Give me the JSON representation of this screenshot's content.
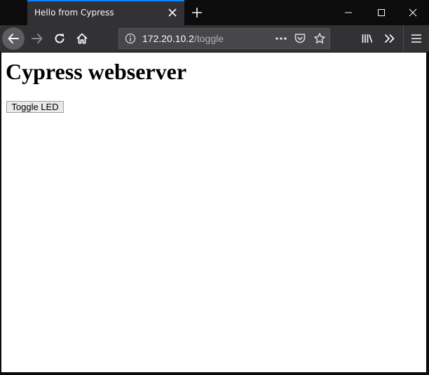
{
  "browser": {
    "tab": {
      "title": "Hello from Cypress"
    },
    "url": {
      "host": "172.20.10.2",
      "path": "/toggle"
    }
  },
  "page": {
    "heading": "Cypress webserver",
    "toggle_button_label": "Toggle LED"
  },
  "icons": {
    "tab_close": "close-icon",
    "new_tab": "plus-icon",
    "minimize": "minimize-icon",
    "maximize": "maximize-icon",
    "window_close": "close-icon",
    "back": "arrow-left-icon",
    "forward": "arrow-right-icon",
    "reload": "reload-icon",
    "home": "home-icon",
    "site_info": "info-icon",
    "page_actions": "ellipsis-icon",
    "pocket": "pocket-icon",
    "bookmark": "star-icon",
    "library": "library-icon",
    "overflow": "double-chevron-icon",
    "menu": "hamburger-icon"
  },
  "colors": {
    "accent": "#0a84ff",
    "titlebar": "#0c0c0d",
    "toolbar": "#323234",
    "urlbar": "#474749"
  }
}
